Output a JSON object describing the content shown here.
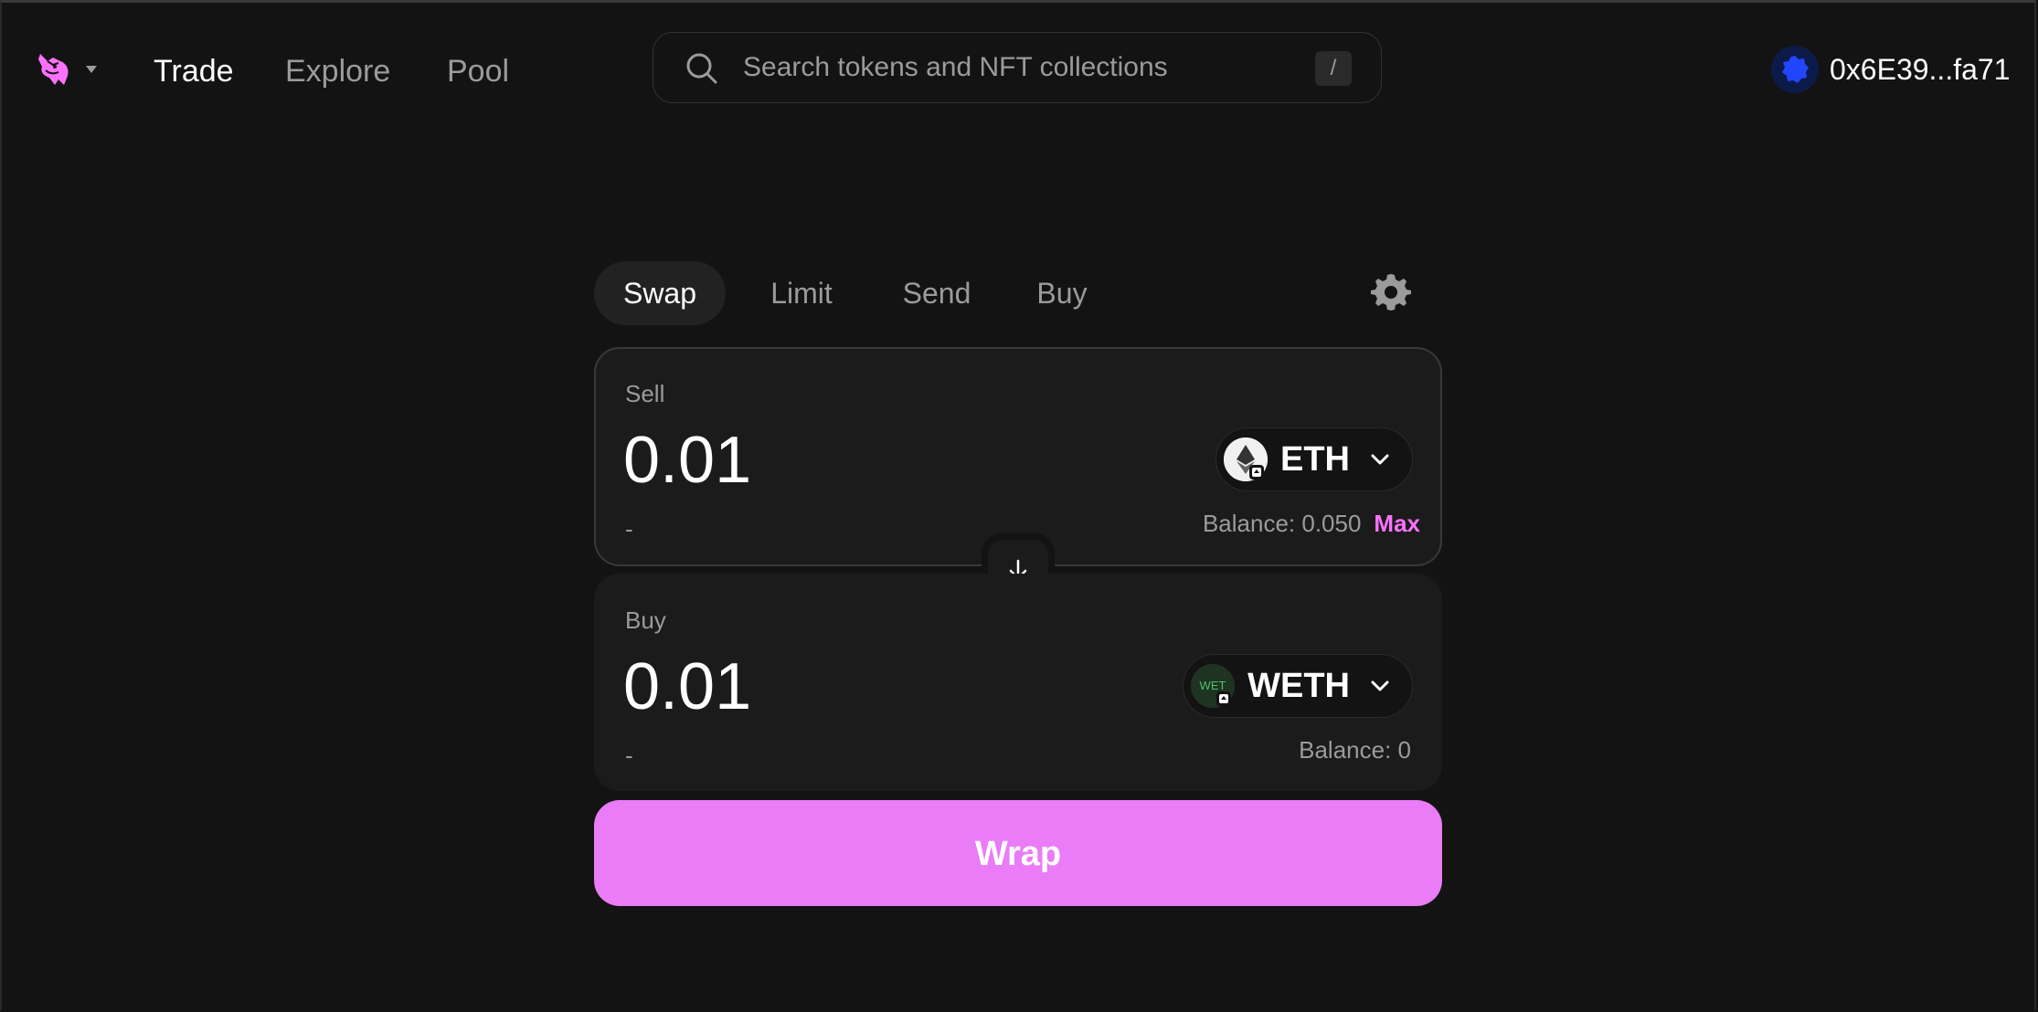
{
  "nav": {
    "links": [
      {
        "label": "Trade",
        "active": true
      },
      {
        "label": "Explore",
        "active": false
      },
      {
        "label": "Pool",
        "active": false
      }
    ],
    "search": {
      "placeholder": "Search tokens and NFT collections",
      "shortcut": "/"
    },
    "account": {
      "address": "0x6E39...fa71"
    },
    "icons": {
      "logo": "uniswap-unicorn-icon",
      "caret": "caret-down-icon",
      "search": "search-icon",
      "avatar": "blue-badge-avatar-icon"
    }
  },
  "tabs": [
    {
      "label": "Swap",
      "active": true
    },
    {
      "label": "Limit",
      "active": false
    },
    {
      "label": "Send",
      "active": false
    },
    {
      "label": "Buy",
      "active": false
    }
  ],
  "settings_icon": "gear-icon",
  "sell": {
    "label": "Sell",
    "amount": "0.01",
    "fiat": "-",
    "token": {
      "symbol": "ETH",
      "icon": "eth-icon"
    },
    "balance": "Balance: 0.050",
    "max_label": "Max"
  },
  "switch_icon": "arrow-down-icon",
  "buy": {
    "label": "Buy",
    "amount": "0.01",
    "fiat": "-",
    "token": {
      "symbol": "WETH",
      "icon": "weth-icon",
      "icon_text": "WET"
    },
    "balance": "Balance: 0"
  },
  "action": {
    "label": "Wrap"
  },
  "colors": {
    "background": "#131313",
    "panel": "#1b1b1b",
    "accent_pink": "#fc72ff",
    "wrap_button": "#ea7cf8",
    "muted_text": "#9b9b9b"
  }
}
